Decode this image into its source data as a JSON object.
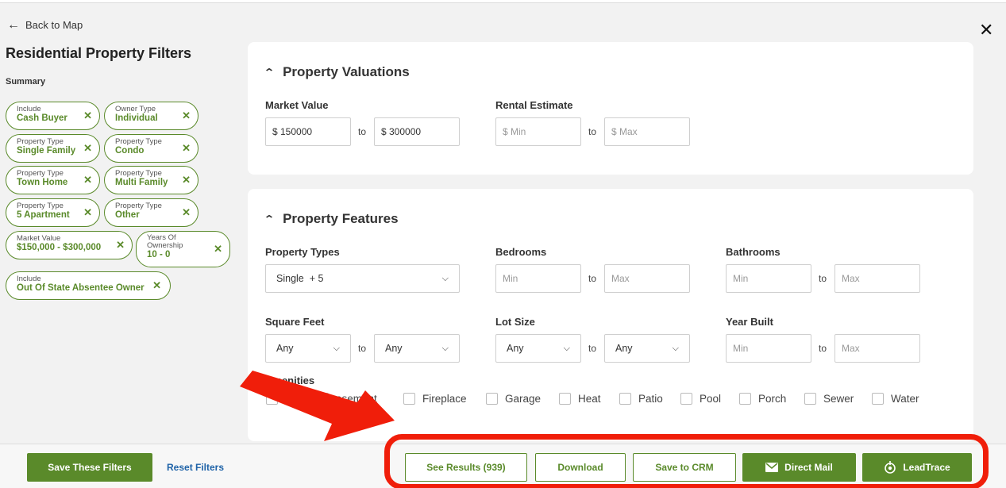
{
  "nav": {
    "back_label": "Back to Map"
  },
  "sidebar": {
    "title": "Residential Property Filters",
    "summary_label": "Summary",
    "chips": [
      {
        "key": "Include",
        "value": "Cash Buyer"
      },
      {
        "key": "Owner Type",
        "value": "Individual"
      },
      {
        "key": "Property Type",
        "value": "Single Family"
      },
      {
        "key": "Property Type",
        "value": "Condo"
      },
      {
        "key": "Property Type",
        "value": "Town Home"
      },
      {
        "key": "Property Type",
        "value": "Multi Family"
      },
      {
        "key": "Property Type",
        "value": "5 Apartment"
      },
      {
        "key": "Property Type",
        "value": "Other"
      },
      {
        "key": "Market Value",
        "value": "$150,000 - $300,000"
      },
      {
        "key": "Years Of Ownership",
        "value": "10 - 0"
      },
      {
        "key": "Include",
        "value": "Out Of State Absentee Owner"
      }
    ],
    "remove_symbol": "✕"
  },
  "close_symbol": "✕",
  "valuations": {
    "heading": "Property Valuations",
    "market_value": {
      "label": "Market Value",
      "min": "$ 150000",
      "max": "$ 300000",
      "to": "to"
    },
    "rental_estimate": {
      "label": "Rental Estimate",
      "min_placeholder": "$ Min",
      "max_placeholder": "$ Max",
      "to": "to"
    }
  },
  "features": {
    "heading": "Property Features",
    "property_types": {
      "label": "Property Types",
      "value": "Single  + 5"
    },
    "bedrooms": {
      "label": "Bedrooms",
      "min_placeholder": "Min",
      "max_placeholder": "Max",
      "to": "to"
    },
    "bathrooms": {
      "label": "Bathrooms",
      "min_placeholder": "Min",
      "max_placeholder": "Max",
      "to": "to"
    },
    "square_feet": {
      "label": "Square Feet",
      "min": "Any",
      "max": "Any",
      "to": "to"
    },
    "lot_size": {
      "label": "Lot Size",
      "min": "Any",
      "max": "Any",
      "to": "to"
    },
    "year_built": {
      "label": "Year Built",
      "min_placeholder": "Min",
      "max_placeholder": "Max",
      "to": "to"
    },
    "amenities_label": "Amenities",
    "amenities": [
      "",
      "asement",
      "Fireplace",
      "Garage",
      "Heat",
      "Patio",
      "Pool",
      "Porch",
      "Sewer",
      "Water"
    ]
  },
  "footer": {
    "save_filters": "Save These Filters",
    "reset_filters": "Reset Filters",
    "see_results": "See Results (939)",
    "download": "Download",
    "save_crm": "Save to CRM",
    "direct_mail": "Direct Mail",
    "leadtrace": "LeadTrace"
  },
  "colors": {
    "brand_green": "#5a8a2a",
    "link_blue": "#1f63a8",
    "annotation_red": "#f01e0a"
  },
  "icons": {
    "back": "arrow-left-icon",
    "chevron_up": "chevron-up-icon",
    "chevron_down": "chevron-down-icon",
    "mail": "mail-icon",
    "target": "target-icon"
  }
}
